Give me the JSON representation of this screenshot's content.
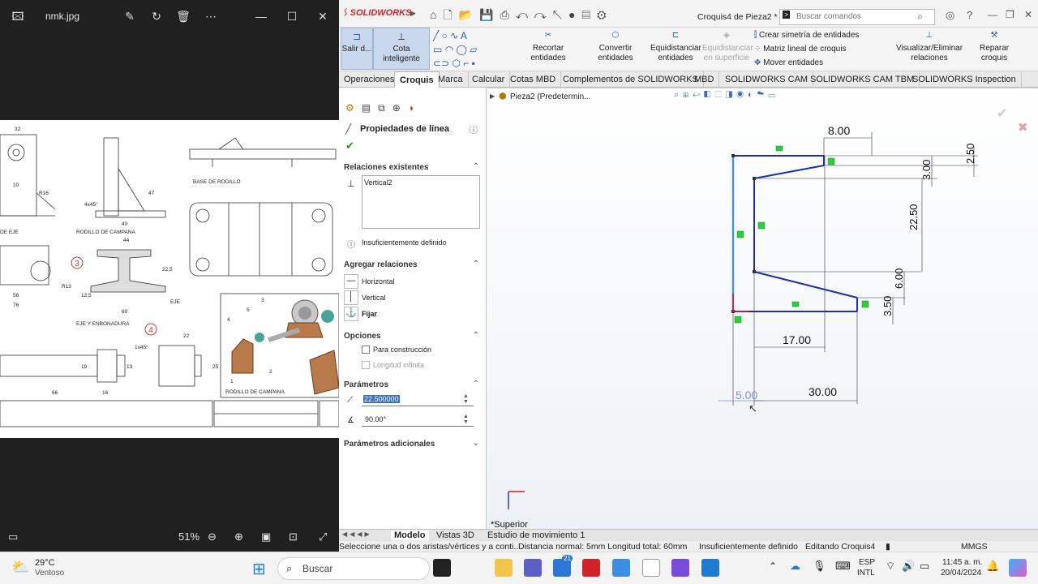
{
  "viewer": {
    "title": "nmk.jpg",
    "zoom": "51%",
    "drawing_labels": {
      "base_rodillo": "BASE DE RODILLO",
      "rodillo_campana": "RODILLO DE CAMPANA",
      "de_eje": "DE EJE",
      "eje": "EJE",
      "eje_enbonadura": "EJE Y ENBONADURA",
      "rodillo_campana_2": "RODILLO DE CAMPANA",
      "num3": "3",
      "num4": "4",
      "r16": "R16",
      "r13": "R13",
      "d10": "10",
      "d47": "47",
      "d40": "40",
      "d32": "32",
      "d60": "60",
      "d56": "56",
      "d76": "76",
      "d66": "66",
      "d16": "16",
      "d13": "13",
      "d19": "19",
      "d22": "22",
      "d25": "25",
      "d44": "44",
      "d22_5": "22,5",
      "d12_5": "12,5",
      "chamfer": "1x45°",
      "chamfer2": "4x45°",
      "p1": "1",
      "p2": "2",
      "p3": "3",
      "p4": "4",
      "p5": "5"
    }
  },
  "solidworks": {
    "brand": "SOLIDWORKS",
    "doc_title": "Croquis4 de Pieza2 *",
    "search_placeholder": "Buscar comandos",
    "ribbon": {
      "exit_sketch": "Salir d...",
      "smart_dim": "Cota inteligente",
      "trim": "Recortar entidades",
      "convert": "Convertir entidades",
      "offset": "Equidistanciar entidades",
      "offset_surface": "Equidistanciar en superficie",
      "mirror": "Crear simetría de entidades",
      "linear_pattern": "Matriz lineal de croquis",
      "move": "Mover entidades",
      "relations": "Visualizar/Eliminar relaciones",
      "repair": "Reparar croquis"
    },
    "tabs": [
      "Operaciones",
      "Croquis",
      "Marca",
      "Calcular",
      "Cotas MBD",
      "Complementos de SOLIDWORKS",
      "MBD",
      "SOLIDWORKS CAM",
      "SOLIDWORKS CAM TBM",
      "SOLIDWORKS Inspection"
    ],
    "tree_root": "Pieza2 (Predetermin...",
    "pm": {
      "title": "Propiedades de línea",
      "existing_rel_hdr": "Relaciones existentes",
      "existing_rel_item": "Vertical2",
      "status": "Insuficientemente definido",
      "add_rel_hdr": "Agregar relaciones",
      "rel_horizontal": "Horizontal",
      "rel_vertical": "Vertical",
      "rel_fix": "Fijar",
      "options_hdr": "Opciones",
      "opt_construction": "Para construcción",
      "opt_infinite": "Longitud infinita",
      "params_hdr": "Parámetros",
      "param_length": "22.500000",
      "param_angle": "90.00°",
      "extra_params_hdr": "Parámetros adicionales"
    },
    "dims": {
      "d8": "8.00",
      "d2_5": "2.50",
      "d3": "3.00",
      "d22_5": "22.50",
      "d6": "6.00",
      "d3_5": "3.50",
      "d17": "17.00",
      "d30": "30.00",
      "d5": "5.00"
    },
    "view_label": "*Superior",
    "bottom_tabs": [
      "Modelo",
      "Vistas 3D",
      "Estudio de movimiento 1"
    ],
    "status": {
      "hint": "Seleccione una o dos aristas/vértices y a conti...",
      "distance": "Distancia normal: 5mm Longitud total: 60mm",
      "defined": "Insuficientemente definido",
      "editing": "Editando Croquis4",
      "units": "MMGS"
    }
  },
  "taskbar": {
    "temp": "29°C",
    "weather": "Ventoso",
    "search": "Buscar",
    "lang1": "ESP",
    "lang2": "INTL",
    "time": "11:45 a. m.",
    "date": "20/04/2024",
    "badge": "21"
  },
  "colors": {
    "sketch_blue": "#1f2fb0",
    "selected_line": "#4a90e2",
    "relation_green": "#2ecc40",
    "sw_red": "#d2232a"
  }
}
